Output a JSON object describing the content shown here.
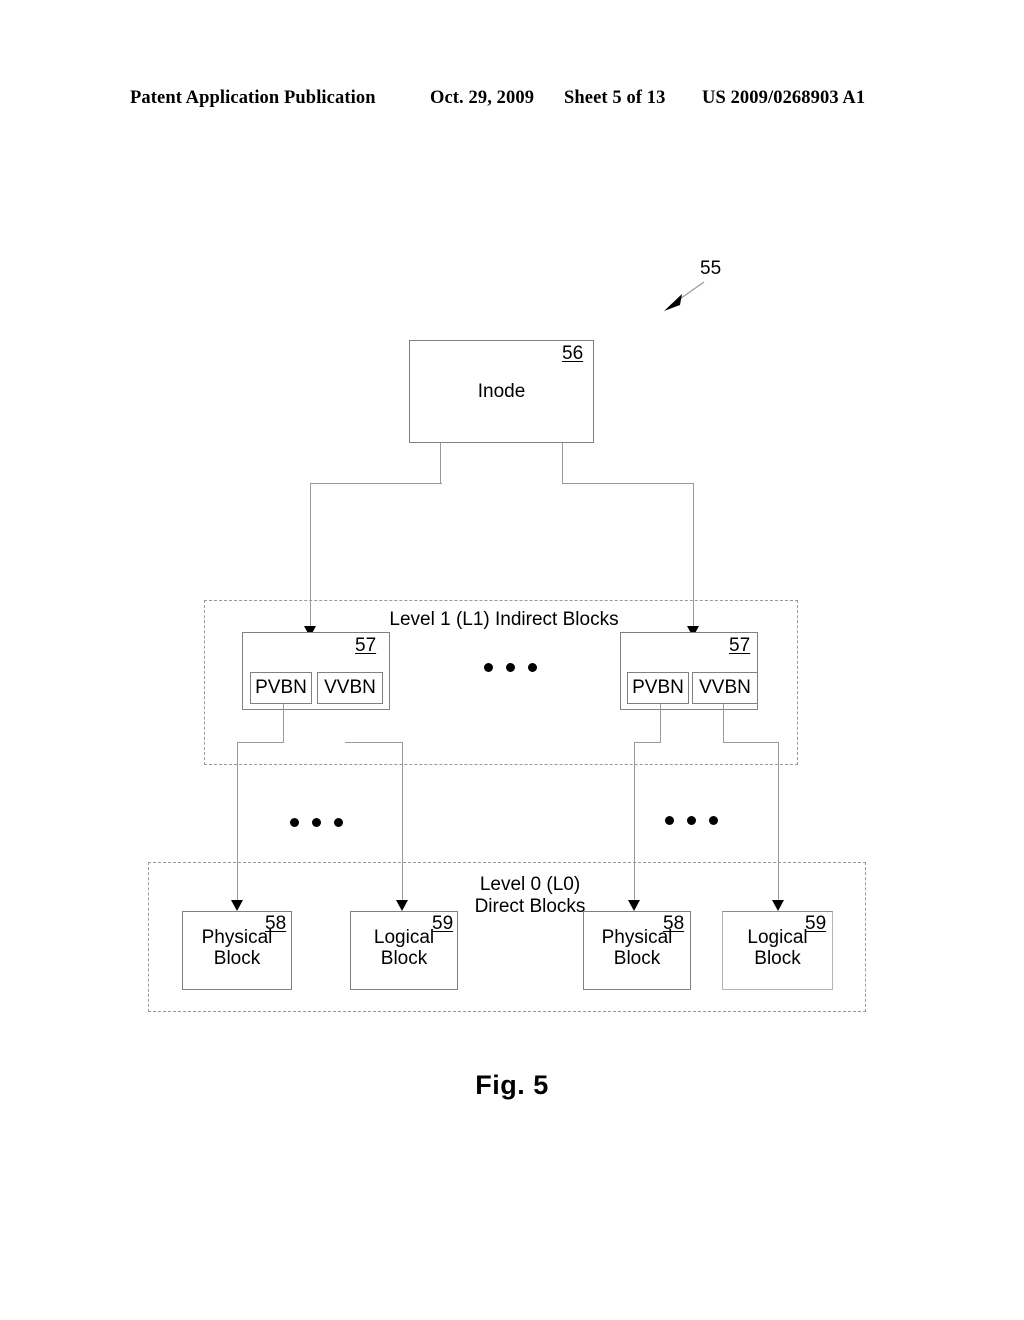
{
  "header": {
    "publication": "Patent Application Publication",
    "date": "Oct. 29, 2009",
    "sheet": "Sheet 5 of 13",
    "number": "US 2009/0268903 A1"
  },
  "figure": {
    "caption": "Fig. 5",
    "diagram_reference": "55"
  },
  "inode": {
    "label": "Inode",
    "ref": "56"
  },
  "level1": {
    "group_label": "Level 1 (L1) Indirect Blocks",
    "blocks": [
      {
        "ref": "57",
        "fields": [
          {
            "label": "PVBN"
          },
          {
            "label": "VVBN"
          }
        ]
      },
      {
        "ref": "57",
        "fields": [
          {
            "label": "PVBN"
          },
          {
            "label": "VVBN"
          }
        ]
      }
    ],
    "ellipsis": "• • •"
  },
  "level0": {
    "group_label": "Level 0 (L0)\nDirect Blocks",
    "blocks": [
      {
        "label": "Physical\nBlock",
        "ref": "58"
      },
      {
        "label": "Logical\nBlock",
        "ref": "59"
      },
      {
        "label": "Physical\nBlock",
        "ref": "58"
      },
      {
        "label": "Logical\nBlock",
        "ref": "59"
      }
    ]
  },
  "colors": {
    "stroke": "#808080",
    "dashed_stroke": "#9a9a9a",
    "text": "#000000",
    "background": "#ffffff"
  }
}
